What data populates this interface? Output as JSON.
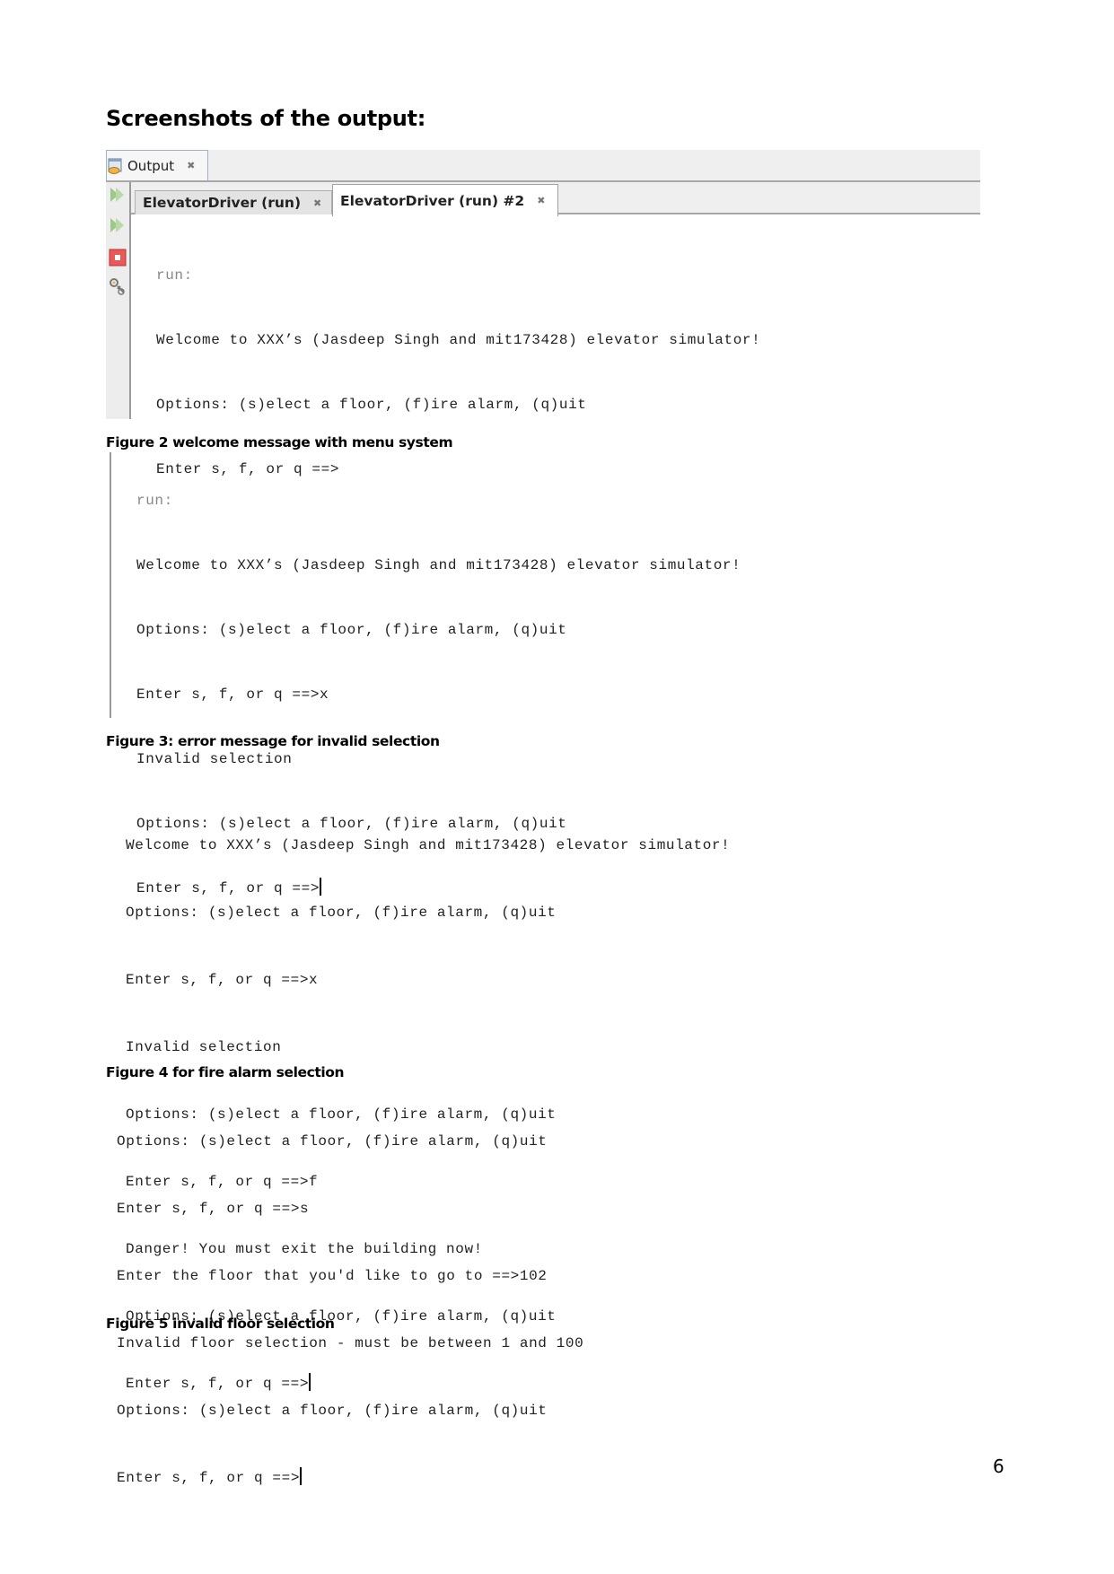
{
  "heading": "Screenshots of the output:",
  "figure1": {
    "output_tab": "Output",
    "tabs": [
      {
        "label": "ElevatorDriver (run)",
        "active": false
      },
      {
        "label": "ElevatorDriver (run) #2",
        "active": true
      }
    ],
    "sidebar_icons": [
      "rerun-icon",
      "rerun-icon",
      "stop-icon",
      "settings-icon"
    ],
    "lines": [
      "run:",
      "Welcome to XXX’s (Jasdeep Singh and mit173428) elevator simulator!",
      "Options: (s)elect a floor, (f)ire alarm, (q)uit",
      "Enter s, f, or q ==>"
    ],
    "caption": "Figure 2 welcome message with menu system"
  },
  "figure2": {
    "lines": [
      "run:",
      "Welcome to XXX’s (Jasdeep Singh and mit173428) elevator simulator!",
      "Options: (s)elect a floor, (f)ire alarm, (q)uit",
      "Enter s, f, or q ==>x",
      "Invalid selection",
      "Options: (s)elect a floor, (f)ire alarm, (q)uit",
      "Enter s, f, or q ==>"
    ],
    "caption": "Figure 3: error message for invalid selection"
  },
  "figure3": {
    "lines": [
      "Welcome to XXX’s (Jasdeep Singh and mit173428) elevator simulator!",
      "Options: (s)elect a floor, (f)ire alarm, (q)uit",
      "Enter s, f, or q ==>x",
      "Invalid selection",
      "Options: (s)elect a floor, (f)ire alarm, (q)uit",
      "Enter s, f, or q ==>f",
      "Danger! You must exit the building now!",
      "Options: (s)elect a floor, (f)ire alarm, (q)uit",
      "Enter s, f, or q ==>"
    ],
    "caption": "Figure 4 for fire alarm selection"
  },
  "figure4": {
    "lines": [
      "Options: (s)elect a floor, (f)ire alarm, (q)uit",
      "Enter s, f, or q ==>s",
      "Enter the floor that you'd like to go to ==>102",
      "Invalid floor selection - must be between 1 and 100",
      "Options: (s)elect a floor, (f)ire alarm, (q)uit",
      "Enter s, f, or q ==>"
    ],
    "caption": "Figure 5 invalid floor selection"
  },
  "page_number": "6"
}
